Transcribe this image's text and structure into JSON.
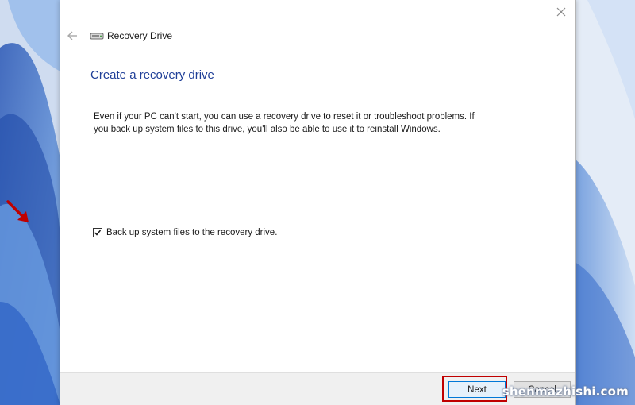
{
  "window": {
    "title": "Recovery Drive",
    "heading": "Create a recovery drive",
    "description_line1": "Even if your PC can't start, you can use a recovery drive to reset it or troubleshoot problems. If",
    "description_line2": "you back up system files to this drive, you'll also be able to use it to reinstall Windows."
  },
  "options": {
    "backup_label": "Back up system files to the recovery drive.",
    "backup_checked": true
  },
  "footer": {
    "next_label": "Next",
    "cancel_label": "Cancel"
  },
  "icons": {
    "close": "close-icon",
    "back": "back-arrow-icon",
    "drive": "drive-icon",
    "check": "checkmark-icon",
    "annotation": "annotation-arrow-icon"
  },
  "colors": {
    "heading": "#1f3f98",
    "highlight": "#c00000",
    "arrow": "#c00000",
    "next_border": "#0078d7"
  },
  "watermark": "shenmazhishi.com"
}
